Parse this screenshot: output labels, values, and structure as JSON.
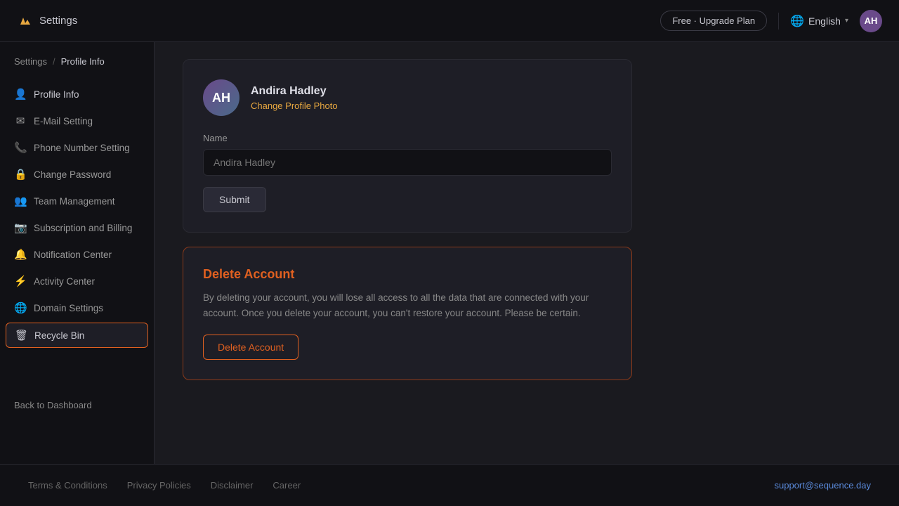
{
  "topbar": {
    "logo_label": "Settings",
    "upgrade_btn": "Free · Upgrade Plan",
    "lang": "English",
    "avatar_initials": "AH"
  },
  "breadcrumb": {
    "parent": "Settings",
    "separator": "/",
    "current": "Profile Info"
  },
  "sidebar": {
    "items": [
      {
        "id": "profile-info",
        "label": "Profile Info",
        "icon": "👤",
        "active": true
      },
      {
        "id": "email-setting",
        "label": "E-Mail Setting",
        "icon": "✉"
      },
      {
        "id": "phone-setting",
        "label": "Phone Number Setting",
        "icon": "📞"
      },
      {
        "id": "change-password",
        "label": "Change Password",
        "icon": "🔒"
      },
      {
        "id": "team-management",
        "label": "Team Management",
        "icon": "👥"
      },
      {
        "id": "subscription-billing",
        "label": "Subscription and Billing",
        "icon": "📷"
      },
      {
        "id": "notification-center",
        "label": "Notification Center",
        "icon": "🔔"
      },
      {
        "id": "activity-center",
        "label": "Activity Center",
        "icon": "⚡"
      },
      {
        "id": "domain-settings",
        "label": "Domain Settings",
        "icon": "🌐"
      },
      {
        "id": "recycle-bin",
        "label": "Recycle Bin",
        "icon": "🗑",
        "selected": true
      }
    ],
    "back_label": "Back to Dashboard"
  },
  "profile": {
    "name": "Andira Hadley",
    "change_photo_link": "Change Profile Photo",
    "name_label": "Name",
    "name_placeholder": "Andira Hadley",
    "submit_label": "Submit"
  },
  "delete_account": {
    "title": "Delete Account",
    "description": "By deleting your account, you will lose all access to all the data that are connected with your account. Once you delete your account, you can't restore your account. Please be certain.",
    "button_label": "Delete Account"
  },
  "footer": {
    "links": [
      {
        "label": "Terms & Conditions"
      },
      {
        "label": "Privacy Policies"
      },
      {
        "label": "Disclaimer"
      },
      {
        "label": "Career"
      }
    ],
    "email": "support@sequence.day"
  }
}
